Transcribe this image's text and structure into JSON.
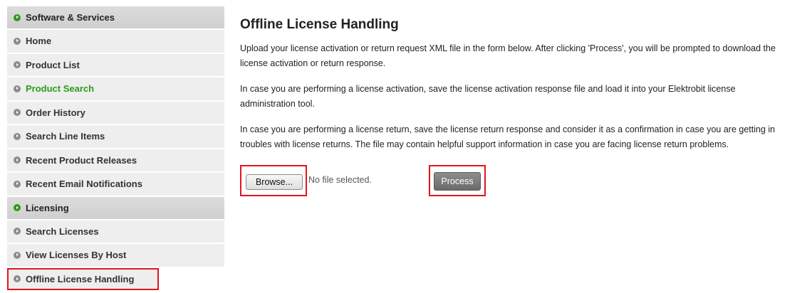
{
  "sidebar": {
    "software_header": "Software & Services",
    "software_items": [
      {
        "label": "Home"
      },
      {
        "label": "Product List"
      },
      {
        "label": "Product Search"
      },
      {
        "label": "Order History"
      },
      {
        "label": "Search Line Items"
      },
      {
        "label": "Recent Product Releases"
      },
      {
        "label": "Recent Email Notifications"
      }
    ],
    "licensing_header": "Licensing",
    "licensing_items": [
      {
        "label": "Search Licenses"
      },
      {
        "label": "View Licenses By Host"
      },
      {
        "label": "Offline License Handling"
      }
    ]
  },
  "main": {
    "title": "Offline License Handling",
    "paragraphs": [
      "Upload your license activation or return request XML file in the form below. After clicking 'Process', you will be prompted to download the license activation or return response.",
      "In case you are performing a license activation, save the license activation response file and load it into your Elektrobit license administration tool.",
      "In case you are performing a license return, save the license return response and consider it as a confirmation in case you are getting in troubles with license returns. The file may contain helpful support information in case you are facing license return problems."
    ],
    "browse_label": "Browse...",
    "file_status": "No file selected.",
    "process_label": "Process"
  },
  "colors": {
    "accent_green": "#2f9a1b",
    "highlight_red": "#e0161b",
    "sidebar_bg": "#eeeeee",
    "header_bg": "#d4d4d4"
  }
}
